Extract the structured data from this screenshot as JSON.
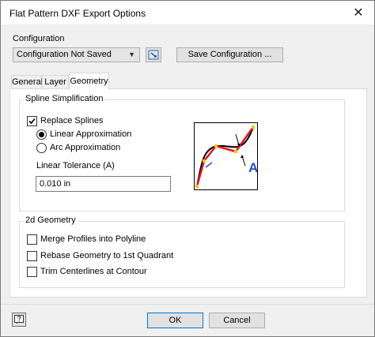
{
  "window": {
    "title": "Flat Pattern DXF Export Options",
    "close_glyph": "✕"
  },
  "configuration": {
    "label": "Configuration",
    "selected": "Configuration Not Saved",
    "save_button": "Save Configuration ..."
  },
  "tabs": [
    {
      "label": "General",
      "active": false
    },
    {
      "label": "Layer",
      "active": false
    },
    {
      "label": "Geometry",
      "active": true
    }
  ],
  "spline_simplification": {
    "title": "Spline Simplification",
    "replace_splines": {
      "label": "Replace Splines",
      "checked": true
    },
    "options": [
      {
        "label": "Linear Approximation",
        "selected": true
      },
      {
        "label": "Arc Approximation",
        "selected": false
      }
    ],
    "tolerance_label": "Linear Tolerance (A)",
    "tolerance_value": "0.010 in",
    "diagram_label": "A"
  },
  "geometry_2d": {
    "title": "2d Geometry",
    "options": [
      {
        "label": "Merge Profiles into Polyline",
        "checked": false
      },
      {
        "label": "Rebase Geometry to 1st Quadrant",
        "checked": false
      },
      {
        "label": "Trim Centerlines at Contour",
        "checked": false
      }
    ]
  },
  "footer": {
    "ok": "OK",
    "cancel": "Cancel"
  },
  "colors": {
    "accent": "#0078d7",
    "diagram_red": "#e8141e",
    "diagram_yellow": "#f5c400",
    "diagram_blue": "#1a4fd8"
  }
}
